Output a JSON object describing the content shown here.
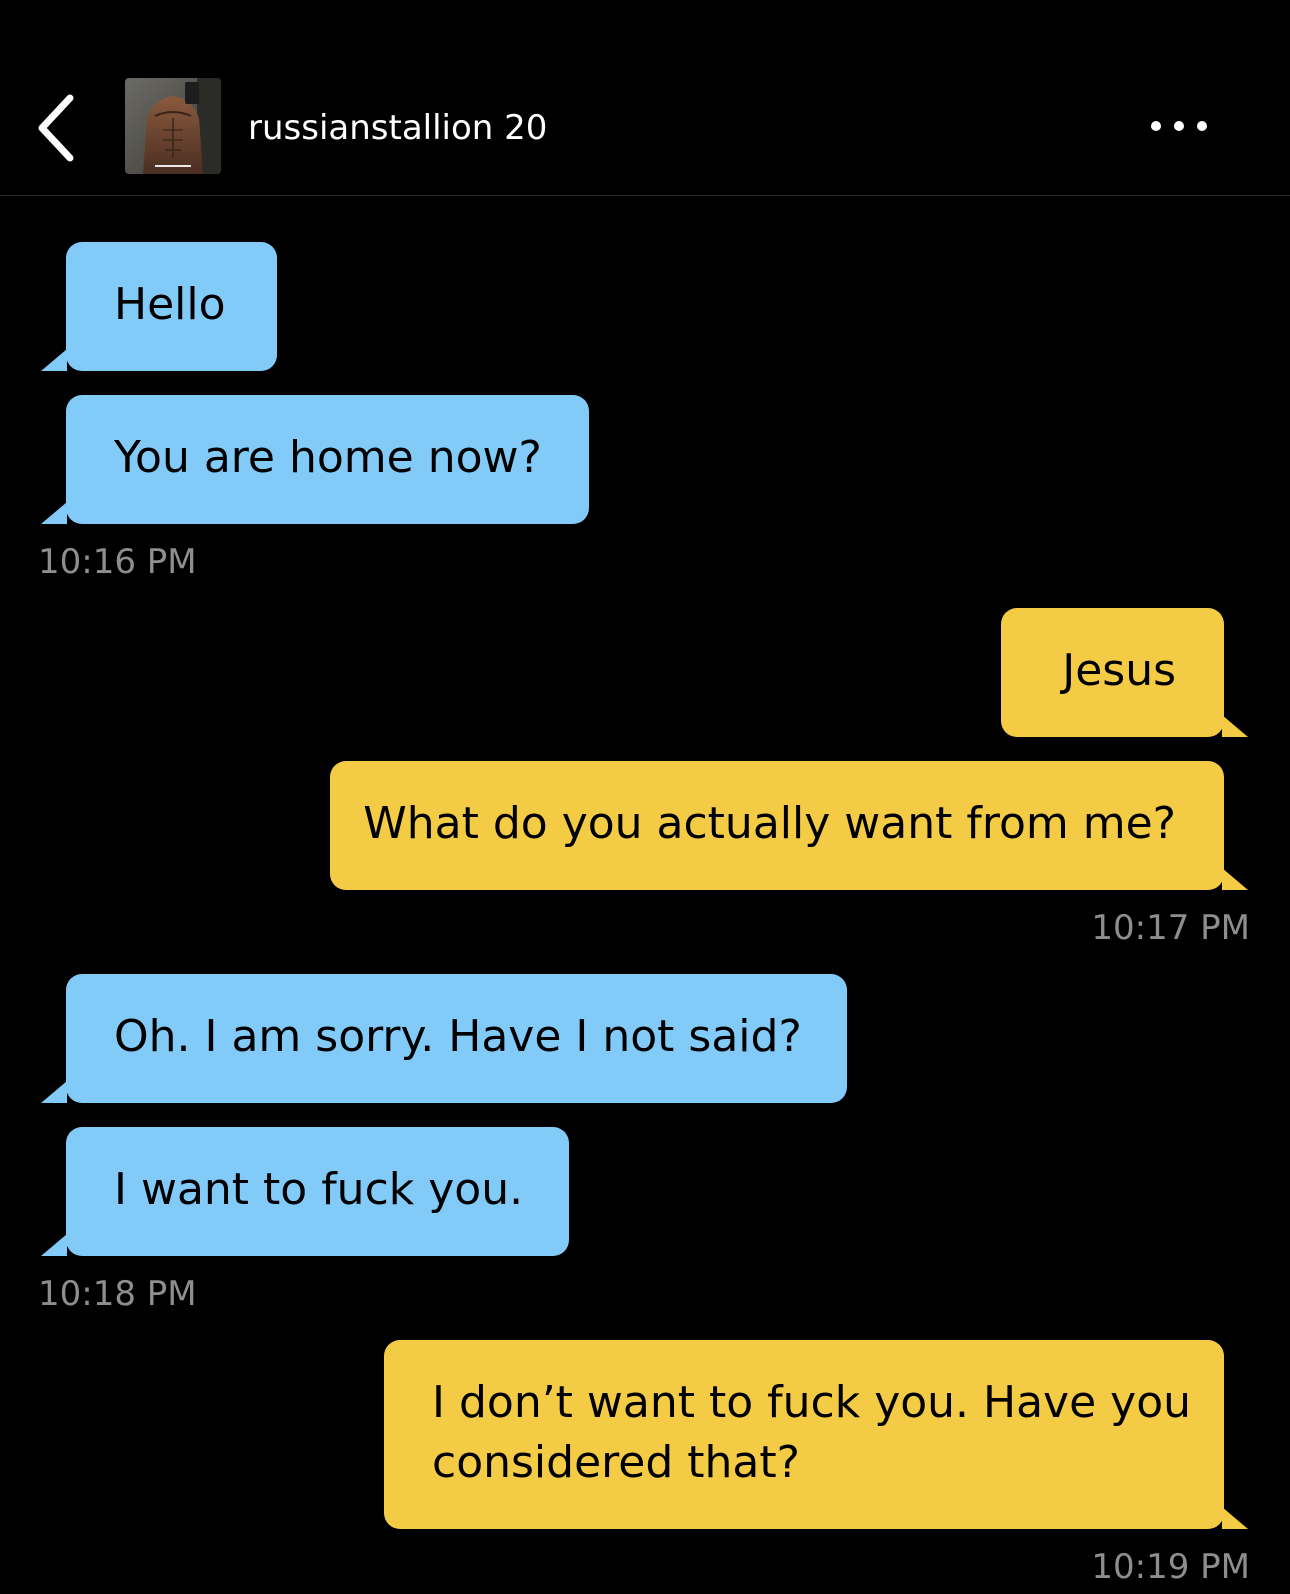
{
  "header": {
    "back_icon": "chevron-left-icon",
    "profile_name": "russianstallion 20",
    "more_icon": "more-horizontal-icon"
  },
  "colors": {
    "background": "#000000",
    "incoming_bubble": "#82CAF8",
    "outgoing_bubble": "#F4CB44",
    "timestamp": "#8E8E8E"
  },
  "messages": [
    {
      "direction": "incoming",
      "text": "Hello"
    },
    {
      "direction": "incoming",
      "text": "You are home now?",
      "timestamp": "10:16 PM"
    },
    {
      "direction": "outgoing",
      "text": "Jesus"
    },
    {
      "direction": "outgoing",
      "text": "What do you actually want from me?",
      "timestamp": "10:17 PM"
    },
    {
      "direction": "incoming",
      "text": "Oh. I am sorry. Have I not said?"
    },
    {
      "direction": "incoming",
      "text": "I want to fuck you.",
      "timestamp": "10:18 PM"
    },
    {
      "direction": "outgoing",
      "lines": [
        "I don’t want to fuck you. Have you",
        "considered that?"
      ],
      "timestamp": "10:19 PM"
    }
  ]
}
